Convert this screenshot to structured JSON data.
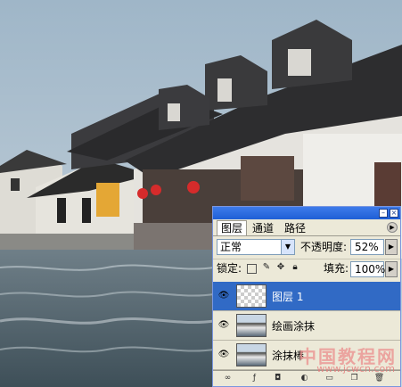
{
  "panel": {
    "tabs": [
      "图层",
      "通道",
      "路径"
    ],
    "blend_mode": "正常",
    "opacity_label": "不透明度:",
    "opacity_value": "52%",
    "lock_label": "锁定:",
    "fill_label": "填充:",
    "fill_value": "100%",
    "layers": [
      {
        "name": "图层 1",
        "selected": true
      },
      {
        "name": "绘画涂抹",
        "selected": false
      },
      {
        "name": "涂抹棒",
        "selected": false
      }
    ]
  },
  "watermark": {
    "cn": "中国教程网",
    "url": "www.jcwcn.com"
  }
}
